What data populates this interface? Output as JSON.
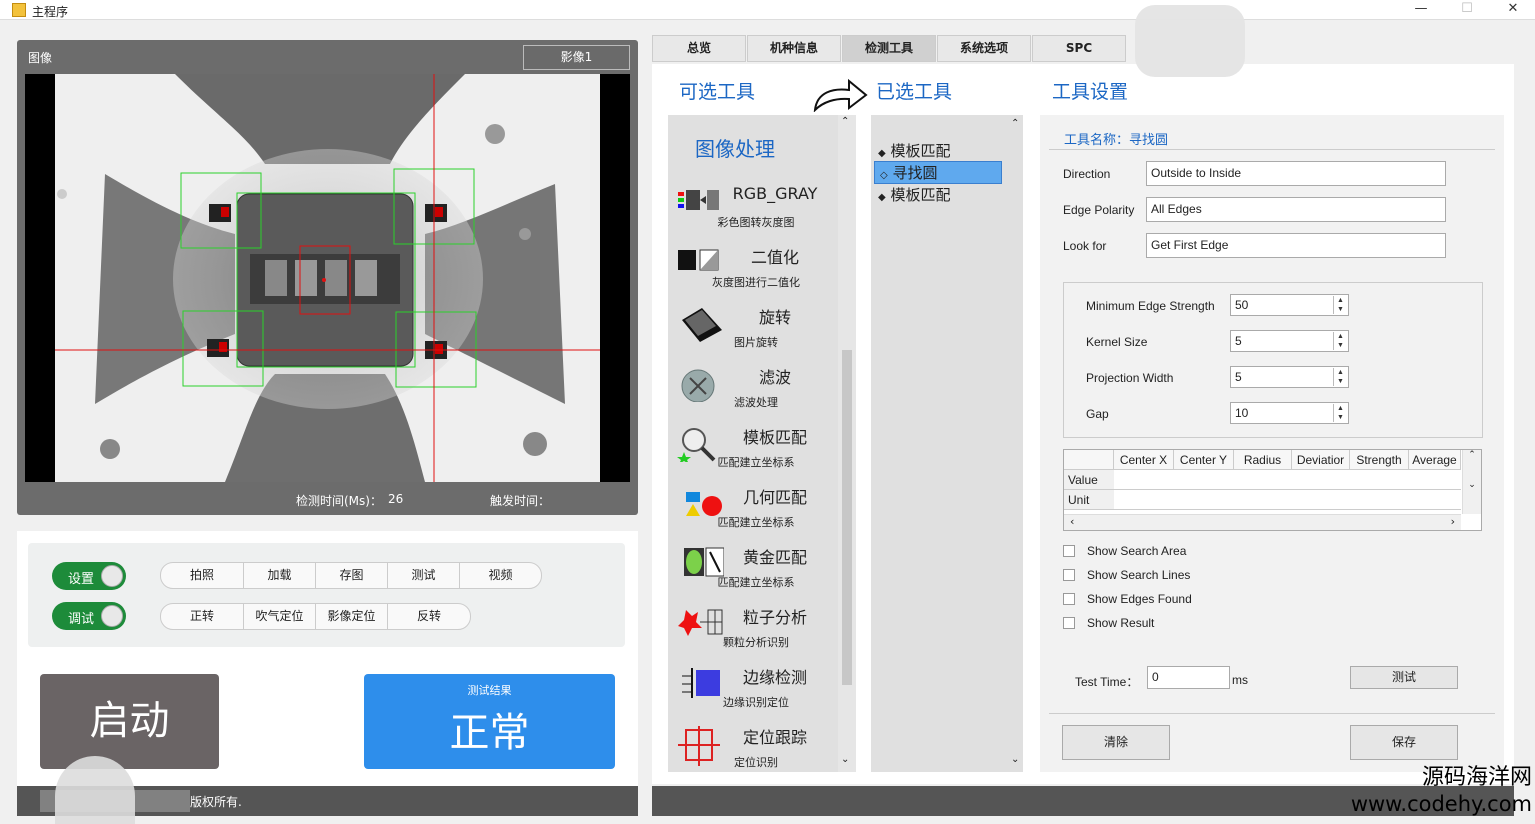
{
  "window": {
    "title": "主程序",
    "minimize": "—",
    "maximize": "☐",
    "close": "✕"
  },
  "left": {
    "image_label": "图像",
    "image_button": "影像1",
    "detect_time_label": "检测时间(Ms)：",
    "detect_time_value": "26",
    "trigger_time_label": "触发时间："
  },
  "controls": {
    "toggle_settings": "设置",
    "toggle_debug": "调试",
    "row1": [
      "拍照",
      "加载",
      "存图",
      "测试",
      "视频"
    ],
    "row2": [
      "正转",
      "吹气定位",
      "影像定位",
      "反转"
    ],
    "start_button": "启动",
    "result_caption": "测试结果",
    "result_value": "正常",
    "copyright": "版权所有."
  },
  "tabs": [
    "总览",
    "机种信息",
    "检测工具",
    "系统选项",
    "SPC"
  ],
  "active_tab": "检测工具",
  "sections": {
    "available": "可选工具",
    "selected": "已选工具",
    "settings": "工具设置"
  },
  "available_tools": {
    "category": "图像处理",
    "items": [
      {
        "name": "RGB_GRAY",
        "desc": "彩色图转灰度图",
        "icon": "rgb-gray-icon"
      },
      {
        "name": "二值化",
        "desc": "灰度图进行二值化",
        "icon": "binarize-icon"
      },
      {
        "name": "旋转",
        "desc": "图片旋转",
        "icon": "rotate-icon"
      },
      {
        "name": "滤波",
        "desc": "滤波处理",
        "icon": "filter-icon"
      },
      {
        "name": "模板匹配",
        "desc": "匹配建立坐标系",
        "icon": "magnifier-icon"
      },
      {
        "name": "几何匹配",
        "desc": "匹配建立坐标系",
        "icon": "shapes-icon"
      },
      {
        "name": "黄金匹配",
        "desc": "匹配建立坐标系",
        "icon": "gauge-icon"
      },
      {
        "name": "粒子分析",
        "desc": "颗粒分析识别",
        "icon": "particle-icon"
      },
      {
        "name": "边缘检测",
        "desc": "边缘识别定位",
        "icon": "edge-icon"
      },
      {
        "name": "定位跟踪",
        "desc": "定位识别",
        "icon": "crosshair-icon"
      }
    ]
  },
  "selected_tools": [
    {
      "bullet": "◆",
      "name": "模板匹配",
      "selected": false
    },
    {
      "bullet": "◇",
      "name": "寻找圆",
      "selected": true
    },
    {
      "bullet": "◆",
      "name": "模板匹配",
      "selected": false
    }
  ],
  "settings": {
    "tool_name": "工具名称：寻找圆",
    "fields": [
      {
        "label": "Direction",
        "value": "Outside to Inside"
      },
      {
        "label": "Edge Polarity",
        "value": "All Edges"
      },
      {
        "label": "Look for",
        "value": "Get First Edge"
      }
    ],
    "params": [
      {
        "label": "Minimum Edge Strength",
        "value": "50"
      },
      {
        "label": "Kernel Size",
        "value": "5"
      },
      {
        "label": "Projection Width",
        "value": "5"
      },
      {
        "label": "Gap",
        "value": "10"
      }
    ],
    "grid": {
      "columns": [
        "Center X",
        "Center Y",
        "Radius",
        "Deviatior",
        "Strength",
        "Average"
      ],
      "rows": [
        "Value",
        "Unit"
      ]
    },
    "checkboxes": [
      "Show Search Area",
      "Show Search Lines",
      "Show Edges Found",
      "Show Result"
    ],
    "test_time_label": "Test Time：",
    "test_time_value": "0",
    "test_time_unit": "ms",
    "test_button": "测试",
    "clear_button": "清除",
    "save_button": "保存"
  },
  "watermark": {
    "line1": "源码海洋网",
    "line2": "www.codehy.com"
  },
  "colors": {
    "accent_green": "#1d8b3a",
    "result_blue": "#2e8eeb",
    "title_blue": "#1c67c4",
    "roi_green": "#2bd12b",
    "crosshair_red": "#e01010"
  }
}
